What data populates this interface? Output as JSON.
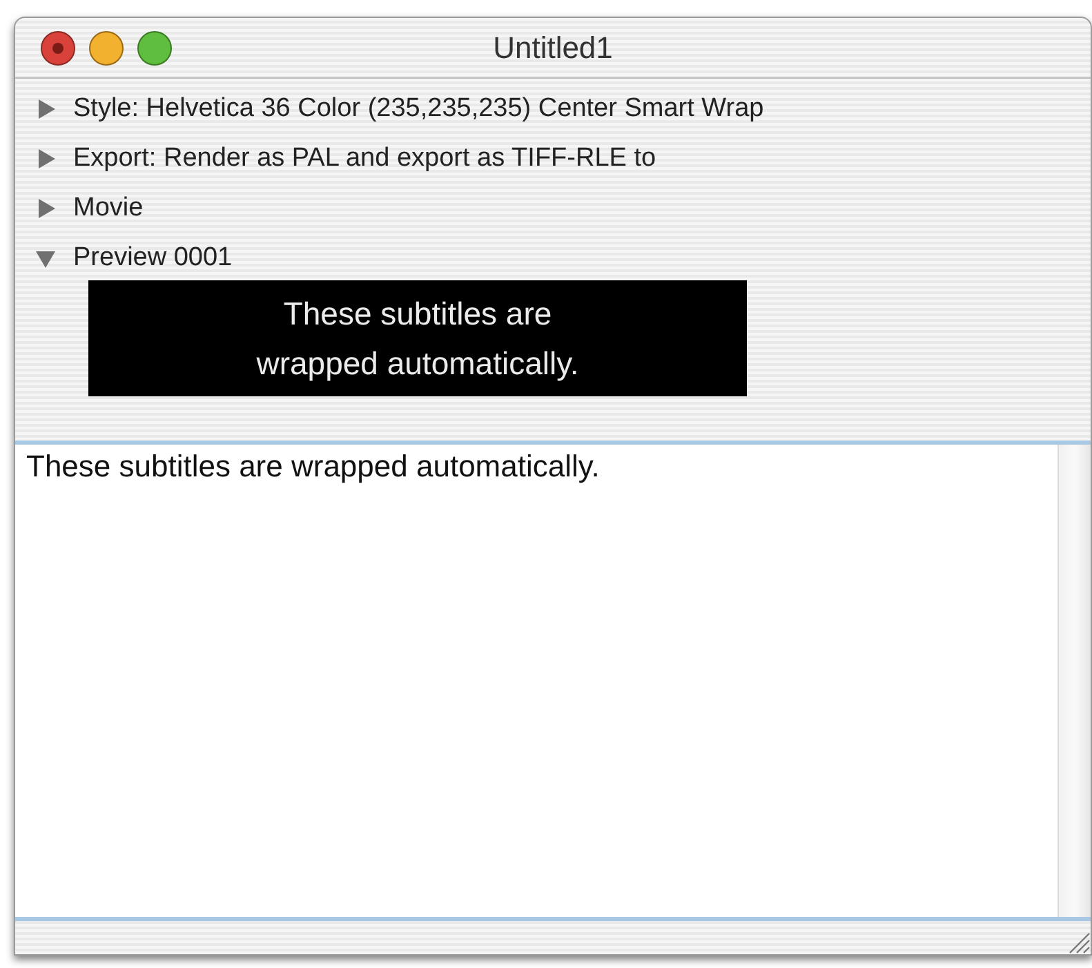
{
  "window": {
    "title": "Untitled1"
  },
  "rows": [
    {
      "label": "Style: Helvetica 36 Color (235,235,235) Center Smart Wrap",
      "expanded": false
    },
    {
      "label": "Export: Render as PAL and export as TIFF-RLE to",
      "expanded": false
    },
    {
      "label": "Movie",
      "expanded": false
    },
    {
      "label": "Preview 0001",
      "expanded": true
    }
  ],
  "preview": {
    "lines": [
      "These subtitles are",
      "wrapped automatically."
    ]
  },
  "text_area": {
    "value": "These subtitles are wrapped automatically."
  }
}
